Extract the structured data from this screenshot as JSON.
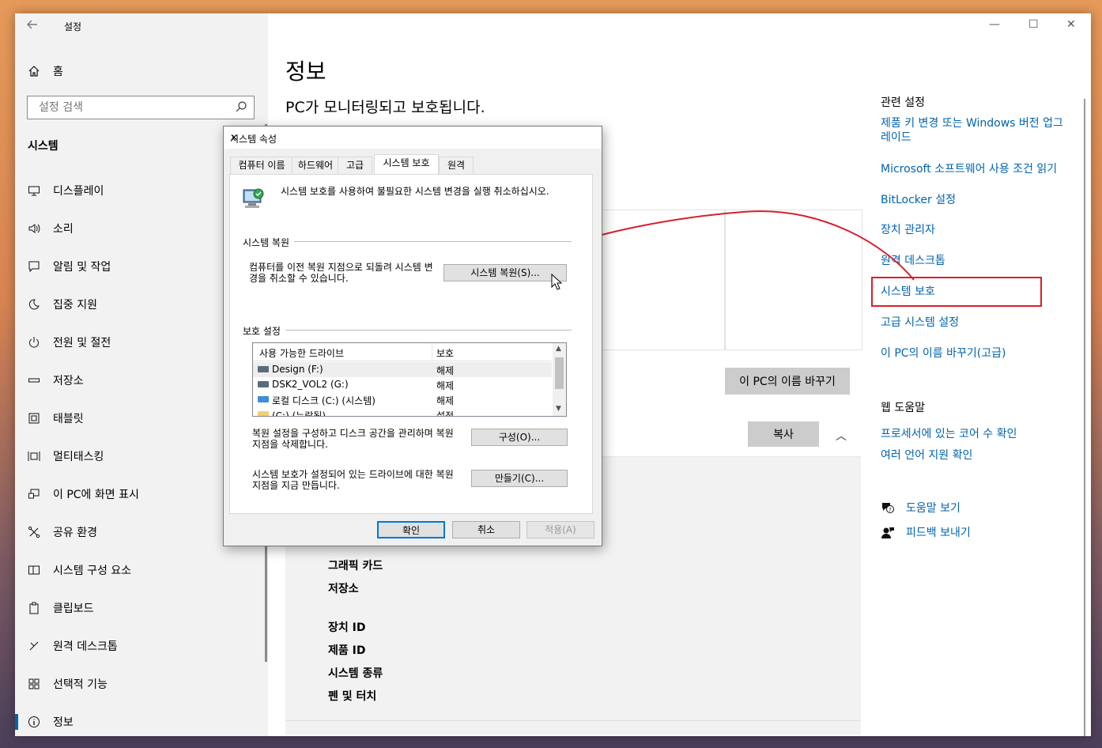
{
  "window": {
    "title": "설정",
    "controls": {
      "minimize": "—",
      "maximize": "☐",
      "close": "✕"
    }
  },
  "sidebar": {
    "home": "홈",
    "search_placeholder": "설정 검색",
    "section": "시스템",
    "items": [
      {
        "label": "디스플레이",
        "icon": "display-icon"
      },
      {
        "label": "소리",
        "icon": "sound-icon"
      },
      {
        "label": "알림 및 작업",
        "icon": "notification-icon"
      },
      {
        "label": "집중 지원",
        "icon": "moon-icon"
      },
      {
        "label": "전원 및 절전",
        "icon": "power-icon"
      },
      {
        "label": "저장소",
        "icon": "storage-icon"
      },
      {
        "label": "태블릿",
        "icon": "tablet-icon"
      },
      {
        "label": "멀티태스킹",
        "icon": "multitask-icon"
      },
      {
        "label": "이 PC에 화면 표시",
        "icon": "project-icon"
      },
      {
        "label": "공유 환경",
        "icon": "share-icon"
      },
      {
        "label": "시스템 구성 요소",
        "icon": "components-icon"
      },
      {
        "label": "클립보드",
        "icon": "clipboard-icon"
      },
      {
        "label": "원격 데스크톱",
        "icon": "remote-desktop-icon"
      },
      {
        "label": "선택적 기능",
        "icon": "features-icon"
      },
      {
        "label": "정보",
        "icon": "info-icon"
      }
    ]
  },
  "main": {
    "title": "정보",
    "subtitle": "PC가 모니터링되고 보호됩니다.",
    "rename_button": "이 PC의 이름 바꾸기",
    "copy_button": "복사",
    "specs": [
      {
        "label": "그래픽 카드"
      },
      {
        "label": "저장소"
      },
      {
        "label": "장치 ID"
      },
      {
        "label": "제품 ID"
      },
      {
        "label": "시스템 종류"
      },
      {
        "label": "펜 및 터치"
      }
    ]
  },
  "related": {
    "heading": "관련 설정",
    "links": [
      "제품 키 변경 또는 Windows 버전 업그레이드",
      "Microsoft 소프트웨어 사용 조건 읽기",
      "BitLocker 설정",
      "장치 관리자",
      "원격 데스크톱",
      "시스템 보호",
      "고급 시스템 설정",
      "이 PC의 이름 바꾸기(고급)"
    ],
    "web_help_heading": "웹 도움말",
    "web_help_links": [
      "프로세서에 있는 코어 수 확인",
      "여러 언어 지원 확인"
    ],
    "help": "도움말 보기",
    "feedback": "피드백 보내기",
    "annotation_color": "#d6202c"
  },
  "dialog": {
    "title": "시스템 속성",
    "tabs": [
      "컴퓨터 이름",
      "하드웨어",
      "고급",
      "시스템 보호",
      "원격"
    ],
    "selected_tab": "시스템 보호",
    "description": "시스템 보호를 사용하여 불필요한 시스템 변경을 실행 취소하십시오.",
    "restore_group": "시스템 복원",
    "restore_text": "컴퓨터를 이전 복원 지점으로 되돌려 시스템 변경을 취소할 수 있습니다.",
    "restore_button": "시스템 복원(S)...",
    "protection_group": "보호 설정",
    "columns": [
      "사용 가능한 드라이브",
      "보호"
    ],
    "drives": [
      {
        "name": "Design (F:)",
        "status": "해제"
      },
      {
        "name": "DSK2_VOL2 (G:)",
        "status": "해제"
      },
      {
        "name": "로컬 디스크 (C:) (시스템)",
        "status": "해제"
      },
      {
        "name": "(C:) (누락됨)",
        "status": "설정"
      }
    ],
    "configure_text": "복원 설정을 구성하고 디스크 공간을 관리하며 복원 지점을 삭제합니다.",
    "configure_button": "구성(O)...",
    "create_text": "시스템 보호가 설정되어 있는 드라이브에 대한 복원 지점을 지금 만듭니다.",
    "create_button": "만들기(C)...",
    "ok": "확인",
    "cancel": "취소",
    "apply": "적용(A)"
  }
}
